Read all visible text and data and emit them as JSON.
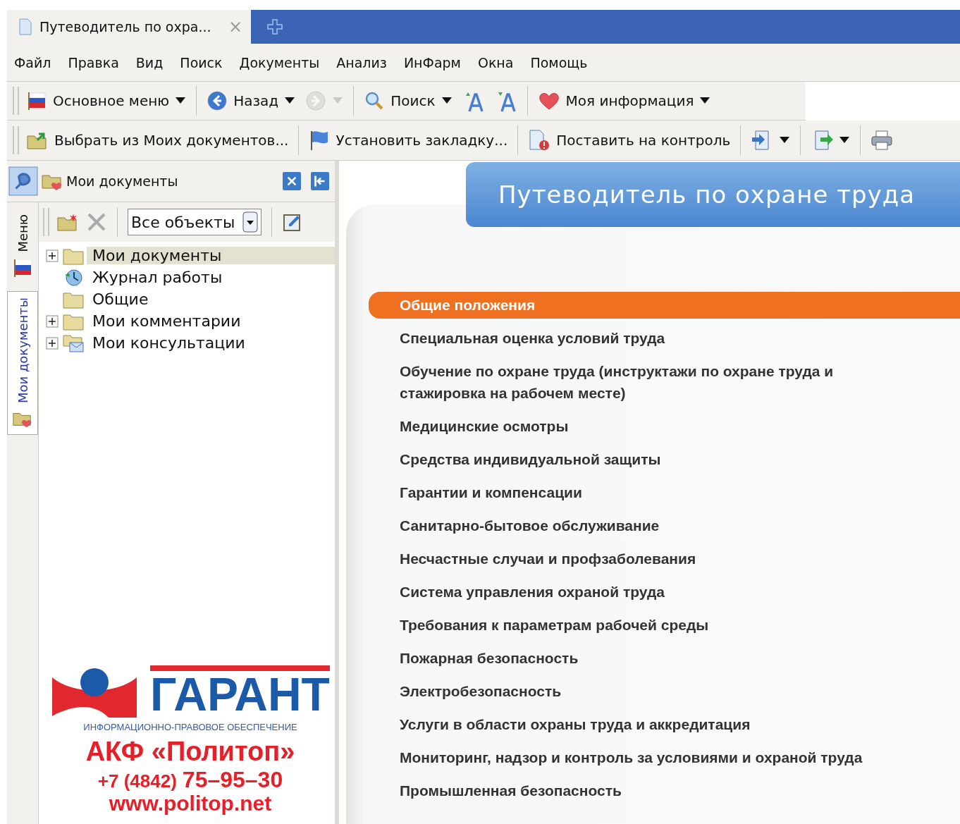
{
  "tab": {
    "title": "Путеводитель по охра...",
    "close": "×"
  },
  "menu": [
    "Файл",
    "Правка",
    "Вид",
    "Поиск",
    "Документы",
    "Анализ",
    "ИнФарм",
    "Окна",
    "Помощь"
  ],
  "toolbar1": [
    {
      "kind": "flag",
      "label": "Основное меню",
      "dropdown": true,
      "disabled": false
    },
    {
      "kind": "back",
      "label": "Назад",
      "dropdown": true,
      "disabled": false
    },
    {
      "kind": "forward",
      "dropdown": true,
      "disabled": true
    },
    {
      "kind": "search",
      "label": "Поиск",
      "dropdown": true,
      "disabled": false
    },
    {
      "kind": "font-up",
      "dropdown": false,
      "disabled": false
    },
    {
      "kind": "font-down",
      "dropdown": false,
      "disabled": false
    },
    {
      "kind": "heart",
      "label": "Моя информация",
      "dropdown": true,
      "disabled": false
    }
  ],
  "toolbar2": [
    {
      "kind": "folder-up",
      "label": "Выбрать из Моих документов...",
      "dropdown": false
    },
    {
      "kind": "bookmark",
      "label": "Установить закладку...",
      "dropdown": false
    },
    {
      "kind": "control",
      "label": "Поставить на контроль",
      "dropdown": false
    },
    {
      "kind": "export",
      "dropdown": true
    },
    {
      "kind": "import",
      "dropdown": true
    },
    {
      "kind": "print",
      "dropdown": false
    }
  ],
  "panel": {
    "title": "Мои документы",
    "side_tabs": [
      {
        "label": "Меню",
        "selected": false
      },
      {
        "label": "Мои документы",
        "selected": true
      }
    ],
    "filter": {
      "value": "Все объекты"
    },
    "tree": [
      {
        "label": "Мои документы",
        "kind": "folder",
        "expandable": true,
        "selected": true
      },
      {
        "label": "Журнал работы",
        "kind": "journal",
        "expandable": false,
        "selected": false
      },
      {
        "label": "Общие",
        "kind": "folder",
        "expandable": false,
        "selected": false
      },
      {
        "label": "Мои комментарии",
        "kind": "folder",
        "expandable": true,
        "selected": false
      },
      {
        "label": "Мои консультации",
        "kind": "mail-folder",
        "expandable": true,
        "selected": false
      }
    ]
  },
  "ad": {
    "logo": "ГАРАНТ",
    "tagline": "ИНФОРМАЦИОННО-ПРАВОВОЕ ОБЕСПЕЧЕНИЕ",
    "company": "АКФ «Политоп»",
    "phone_code": "+7 (4842)",
    "phone": "75–95–30",
    "site": "www.politop.net"
  },
  "content": {
    "title": "Путеводитель по охране труда",
    "sections": [
      {
        "label": "Общие положения",
        "selected": true
      },
      {
        "label": "Специальная оценка условий труда",
        "selected": false
      },
      {
        "label": "Обучение по охране труда (инструктажи по охране труда и стажировка на рабочем месте)",
        "selected": false
      },
      {
        "label": "Медицинские осмотры",
        "selected": false
      },
      {
        "label": "Средства индивидуальной защиты",
        "selected": false
      },
      {
        "label": "Гарантии и компенсации",
        "selected": false
      },
      {
        "label": "Санитарно-бытовое обслуживание",
        "selected": false
      },
      {
        "label": "Несчастные случаи и профзаболевания",
        "selected": false
      },
      {
        "label": "Система управления охраной труда",
        "selected": false
      },
      {
        "label": "Требования к параметрам рабочей среды",
        "selected": false
      },
      {
        "label": "Пожарная безопасность",
        "selected": false
      },
      {
        "label": "Электробезопасность",
        "selected": false
      },
      {
        "label": "Услуги в области охраны труда и аккредитация",
        "selected": false
      },
      {
        "label": "Мониторинг, надзор и контроль за условиями и охраной труда",
        "selected": false
      },
      {
        "label": "Промышленная безопасность",
        "selected": false
      }
    ]
  }
}
